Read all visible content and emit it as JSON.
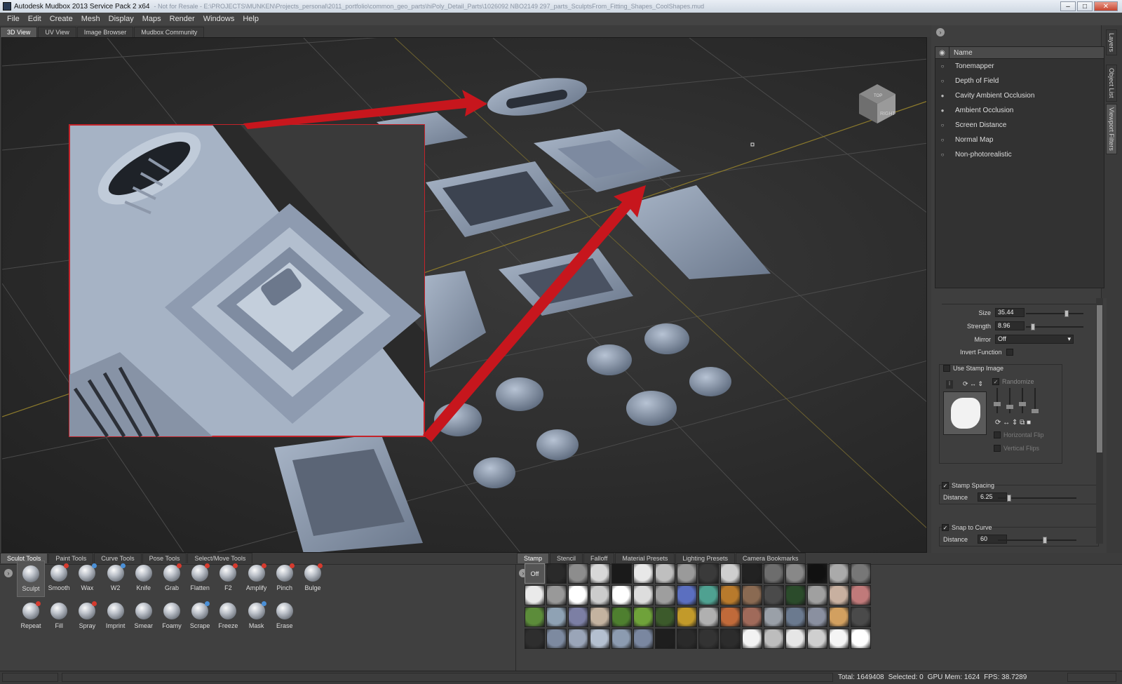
{
  "window": {
    "title": "Autodesk Mudbox 2013 Service Pack 2 x64",
    "path": "- Not for Resale - E:\\PROJECTS\\MUNKEN\\Projects_personal\\2011_portfolio\\common_geo_parts\\hiPoly_Detail_Parts\\1026092 NBO2149 297_parts_SculptsFrom_Fitting_Shapes_CoolShapes.mud",
    "buttons": [
      "–",
      "□",
      "✕"
    ]
  },
  "menu": [
    "File",
    "Edit",
    "Create",
    "Mesh",
    "Display",
    "Maps",
    "Render",
    "Windows",
    "Help"
  ],
  "view_tabs": [
    "3D View",
    "UV View",
    "Image Browser",
    "Mudbox Community"
  ],
  "view_tabs_active": 0,
  "viewcube": {
    "face": "RIGHT",
    "top": "TOP"
  },
  "side_tabs": [
    "Layers",
    "Object List",
    "Viewport Filters"
  ],
  "filters": {
    "header": "Name",
    "items": [
      {
        "label": "Tonemapper",
        "on": false
      },
      {
        "label": "Depth of Field",
        "on": false
      },
      {
        "label": "Cavity Ambient Occlusion",
        "on": true
      },
      {
        "label": "Ambient Occlusion",
        "on": true
      },
      {
        "label": "Screen Distance",
        "on": false
      },
      {
        "label": "Normal Map",
        "on": false
      },
      {
        "label": "Non-photorealistic",
        "on": false
      }
    ]
  },
  "props": {
    "size_label": "Size",
    "size_value": "35.44",
    "size_level": 0.72,
    "strength_label": "Strength",
    "strength_value": "8.96",
    "strength_level": 0.09,
    "mirror_label": "Mirror",
    "mirror_value": "Off",
    "invert_label": "Invert Function",
    "use_stamp_label": "Use Stamp Image",
    "randomize_label": "Randomize",
    "hflip_label": "Horizontal Flip",
    "vflip_label": "Vertical Flips",
    "stamp_spacing_label": "Stamp Spacing",
    "stamp_distance_label": "Distance",
    "stamp_distance_value": "6.25",
    "stamp_distance_level": 0.12,
    "snap_curve_label": "Snap to Curve",
    "snap_distance_label": "Distance",
    "snap_distance_value": "60",
    "snap_distance_level": 0.6
  },
  "tool_tabs": [
    "Sculpt Tools",
    "Paint Tools",
    "Curve Tools",
    "Pose Tools",
    "Select/Move Tools"
  ],
  "tool_tabs_active": 0,
  "tools_row1": [
    "Sculpt",
    "Smooth",
    "Wax",
    "W2",
    "Knife",
    "Grab",
    "Flatten",
    "F2",
    "Amplify",
    "Pinch",
    "Bulge"
  ],
  "tools_row2": [
    "Repeat",
    "Fill",
    "Spray",
    "Imprint",
    "Smear",
    "Foamy",
    "Scrape",
    "Freeze",
    "Mask",
    "Erase"
  ],
  "stamp_tabs": [
    "Stamp",
    "Stencil",
    "Falloff",
    "Material Presets",
    "Lighting Presets",
    "Camera Bookmarks"
  ],
  "stamp_tabs_active": 0,
  "stamp_off_label": "Off",
  "stamp_colors": [
    [
      "#2a2a2a",
      "#8d8d8d",
      "#d8d8d8",
      "#1a1a1a",
      "#e8e8e8",
      "#bfbfbf",
      "#9a9a9a",
      "#3a3a3a",
      "#cfcfcf",
      "#222222",
      "#6d6d6d",
      "#888888",
      "#111111",
      "#aaaaaa",
      "#777777"
    ],
    [
      "#eaeaea",
      "#999999",
      "#ffffff",
      "#cccccc",
      "#ffffff",
      "#dddddd",
      "#9e9e9e",
      "#5b6fc0",
      "#4fa191",
      "#b87a2c",
      "#8a6a52",
      "#4a4a4a",
      "#2b4b2b",
      "#a0a0a0",
      "#c8b0a0",
      "#c07a7a"
    ],
    [
      "#5c8c3a",
      "#8fa2b4",
      "#7c7fa4",
      "#c4b3a0",
      "#4e7f2f",
      "#6fa23a",
      "#3c5a2b",
      "#c29a2a",
      "#b0b0b0",
      "#c06a3a",
      "#a06a5a",
      "#9aa0a8",
      "#6b7a8f",
      "#8a90a0",
      "#d2a060",
      "#4a4a4a"
    ],
    [
      "#2e2e2e",
      "#7d8aa0",
      "#9aa5b8",
      "#b4c0d0",
      "#8c9bb0",
      "#7a87a0",
      "#1e1e1e",
      "#2a2a2a",
      "#333333",
      "#2c2c2c",
      "#f2f2f2",
      "#bdbdbd",
      "#e6e6e6",
      "#cfcfcf",
      "#f5f5f5",
      "#ffffff"
    ]
  ],
  "status": {
    "total": "Total: 1649408",
    "selected": "Selected: 0",
    "gpu": "GPU Mem: 1624",
    "fps": "FPS: 38.7289"
  }
}
